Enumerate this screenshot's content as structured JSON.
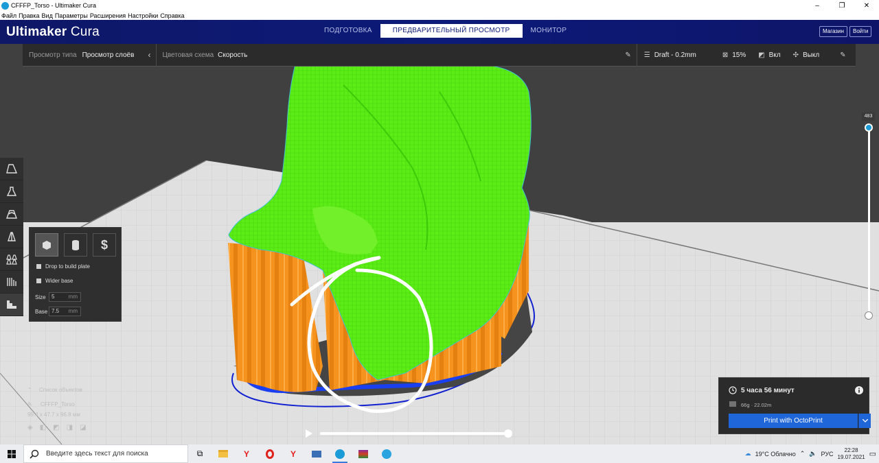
{
  "window": {
    "title": "CFFFP_Torso - Ultimaker Cura",
    "minimize": "–",
    "maximize": "❐",
    "close": "✕"
  },
  "menu": [
    "Файл",
    "Правка",
    "Вид",
    "Параметры",
    "Расширения",
    "Настройки",
    "Справка"
  ],
  "header": {
    "brand_bold": "Ultimaker",
    "brand_light": "Cura",
    "tabs": [
      {
        "label": "ПОДГОТОВКА",
        "active": false
      },
      {
        "label": "ПРЕДВАРИТЕЛЬНЫЙ ПРОСМОТР",
        "active": true
      },
      {
        "label": "МОНИТОР",
        "active": false
      }
    ],
    "marketplace": "Магазин",
    "signin": "Войти"
  },
  "view_bar": {
    "view_type_label": "Просмотр типа",
    "view_type_value": "Просмотр слоёв",
    "color_scheme_label": "Цветовая схема",
    "color_scheme_value": "Скорость",
    "profile": "Draft - 0.2mm",
    "infill": "15%",
    "support": "Вкл",
    "adhesion": "Выкл"
  },
  "tools": [
    "move-tool-icon",
    "scale-tool-icon",
    "rotate-tool-icon",
    "mirror-tool-icon",
    "per-model-settings-icon",
    "support-blocker-icon",
    "tree-support-icon"
  ],
  "support_panel": {
    "drop_to_build_plate": "Drop to build plate",
    "wider_base": "Wider base",
    "size_label": "Size",
    "size_value": "5",
    "base_label": "Base",
    "base_value": "7.5",
    "unit": "mm"
  },
  "objects": {
    "list_label": "Список объектов",
    "object_name": "CFFFP_Torso",
    "dimensions": "99.4 x 47.7 x 96.8 мм"
  },
  "layer_slider": {
    "current_layer": "483"
  },
  "print_panel": {
    "time": "5 часа 56 минут",
    "material": "66g · 22.02m",
    "button": "Print with OctoPrint"
  },
  "taskbar": {
    "search_placeholder": "Введите здесь текст для поиска",
    "weather": "19°C  Облачно",
    "language": "РУС",
    "time": "22:28",
    "date": "19.07.2021"
  },
  "colors": {
    "header_bg": "#0c1a79",
    "model_green": "#55ee11",
    "support_orange": "#f7941d",
    "accent_blue": "#1f66d9"
  }
}
